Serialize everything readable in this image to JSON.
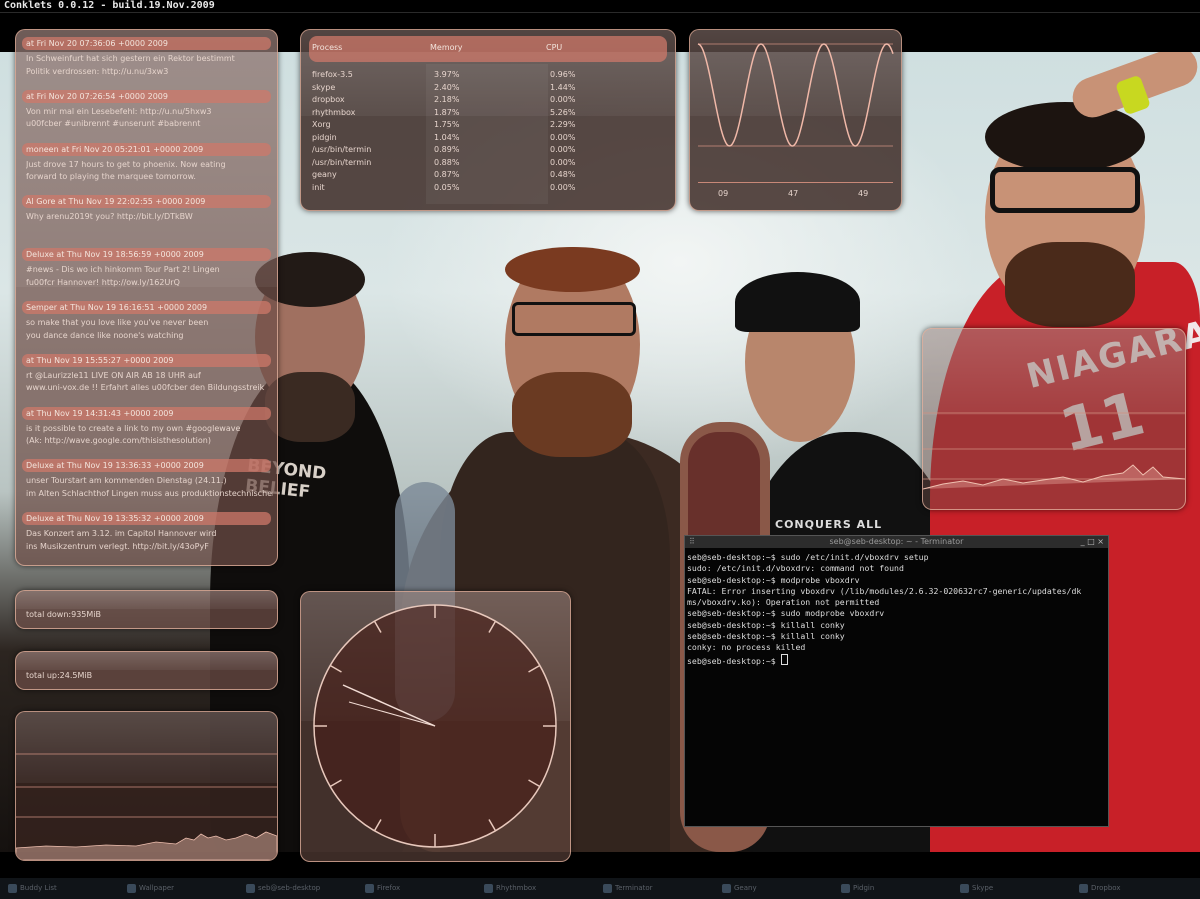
{
  "top_bar": {
    "title": "Conklets 0.0.12 - build.19.Nov.2009"
  },
  "twitter_feed": [
    {
      "header": "at Fri Nov 20 07:36:06 +0000 2009",
      "lines": [
        "In Schweinfurt hat sich gestern ein Rektor bestimmt",
        "Politik verdrossen: http://u.nu/3xw3"
      ]
    },
    {
      "header": "at Fri Nov 20 07:26:54 +0000 2009",
      "lines": [
        "Von mir mal ein Lesebefehl: http://u.nu/5hxw3",
        "u00fcber #unibrennt #unserunt #babrennt"
      ]
    },
    {
      "header": "moneen at Fri Nov 20 05:21:01 +0000 2009",
      "lines": [
        "Just drove 17 hours to get to phoenix. Now eating",
        "forward to playing the marquee tomorrow."
      ]
    },
    {
      "header": "Al Gore at Thu Nov 19 22:02:55 +0000 2009",
      "lines": [
        "Why arenu2019t you? http://bit.ly/DTkBW"
      ]
    },
    {
      "header": "Deluxe at Thu Nov 19 18:56:59 +0000 2009",
      "lines": [
        "#news - Dis wo ich hinkomm Tour Part 2! Lingen",
        "fu00fcr Hannover! http://ow.ly/162UrQ"
      ]
    },
    {
      "header": "Semper at Thu Nov 19 16:16:51 +0000 2009",
      "lines": [
        "so make that you love like you've never been",
        "you dance dance like noone's watching"
      ]
    },
    {
      "header": "at Thu Nov 19 15:55:27 +0000 2009",
      "lines": [
        "rt @Laurizzle11 LIVE ON AIR AB 18 UHR auf",
        "www.uni-vox.de !! Erfahrt alles u00fcber den Bildungsstreik"
      ]
    },
    {
      "header": "at Thu Nov 19 14:31:43 +0000 2009",
      "lines": [
        "is it possible to create a link to my own #googlewave",
        "(Ak: http://wave.google.com/thisisthesolution)"
      ]
    },
    {
      "header": "Deluxe at Thu Nov 19 13:36:33 +0000 2009",
      "lines": [
        "unser Tourstart am kommenden Dienstag (24.11.)",
        "im Alten Schlachthof Lingen muss aus produktionstechnischen"
      ]
    },
    {
      "header": "Deluxe at Thu Nov 19 13:35:32 +0000 2009",
      "lines": [
        "Das Konzert am 3.12. im Capitol Hannover wird",
        "ins Musikzentrum verlegt. http://bit.ly/43oPyF"
      ]
    }
  ],
  "process_table": {
    "headers": [
      "Process",
      "Memory",
      "CPU"
    ],
    "rows": [
      [
        "firefox-3.5",
        "3.97%",
        "0.96%"
      ],
      [
        "skype",
        "2.40%",
        "1.44%"
      ],
      [
        "dropbox",
        "2.18%",
        "0.00%"
      ],
      [
        "rhythmbox",
        "1.87%",
        "5.26%"
      ],
      [
        "Xorg",
        "1.75%",
        "2.29%"
      ],
      [
        "pidgin",
        "1.04%",
        "0.00%"
      ],
      [
        "/usr/bin/termin",
        "0.89%",
        "0.00%"
      ],
      [
        "/usr/bin/termin",
        "0.88%",
        "0.00%"
      ],
      [
        "geany",
        "0.87%",
        "0.48%"
      ],
      [
        "init",
        "0.05%",
        "0.00%"
      ]
    ]
  },
  "wave_widget": {
    "labels": [
      "09",
      "47",
      "49"
    ]
  },
  "net": {
    "down": "total down:935MiB",
    "up": "total up:24.5MiB"
  },
  "terminal": {
    "title": "seb@seb-desktop: ~ - Terminator",
    "lines": [
      "seb@seb-desktop:~$ sudo /etc/init.d/vboxdrv setup",
      "sudo: /etc/init.d/vboxdrv: command not found",
      "seb@seb-desktop:~$ modprobe vboxdrv",
      "FATAL: Error inserting vboxdrv (/lib/modules/2.6.32-020632rc7-generic/updates/dk",
      "ms/vboxdrv.ko): Operation not permitted",
      "seb@seb-desktop:~$ sudo modprobe vboxdrv",
      "seb@seb-desktop:~$ killall conky",
      "seb@seb-desktop:~$ killall conky",
      "conky: no process killed"
    ],
    "prompt": "seb@seb-desktop:~$ "
  },
  "wallpaper": {
    "shirt_text": "NIAGARA",
    "shirt_number": "11",
    "tee_text": "BEYOND BELIEF",
    "tee2_text": "CONQUERS ALL"
  },
  "taskbar": [
    "Buddy List",
    "Wallpaper",
    "seb@seb-desktop",
    "Firefox",
    "Rhythmbox",
    "Terminator",
    "Geany",
    "Pidgin",
    "Skype",
    "Dropbox"
  ]
}
